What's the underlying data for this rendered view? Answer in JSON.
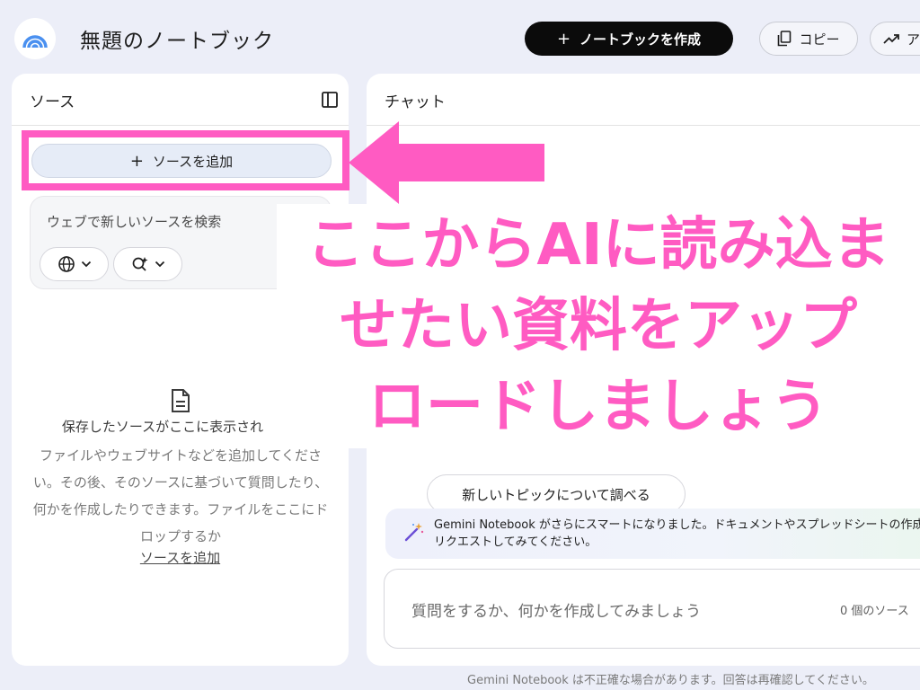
{
  "header": {
    "notebook_title": "無題のノートブック",
    "create_button": "ノートブックを作成",
    "copy_button": "コピー",
    "analyze_button": "ア"
  },
  "sources_panel": {
    "title": "ソース",
    "add_source_button": "ソースを追加",
    "search_placeholder": "ウェブで新しいソースを検索",
    "empty_title": "保存したソースがここに表示され",
    "empty_body": "ファイルやウェブサイトなどを追加してください。その後、そのソースに基づいて質問したり、何かを作成したりできます。ファイルをここにドロップするか",
    "empty_link": "ソースを追加"
  },
  "chat_panel": {
    "title": "チャット",
    "topic_chip": "新しいトピックについて調べる",
    "promo_text": "Gemini Notebook がさらにスマートになりました。ドキュメントやスプレッドシートの作成をリクエストしてみてください。",
    "input_placeholder": "質問をするか、何かを作成してみましょう",
    "source_count": "0 個のソース"
  },
  "footer": {
    "disclaimer": "Gemini Notebook は不正確な場合があります。回答は再確認してください。"
  },
  "annotation": {
    "line1": "ここからAIに読み込ま",
    "line2": "せたい資料をアップ",
    "line3": "ロードしましょう",
    "color": "#ff5bc2"
  }
}
